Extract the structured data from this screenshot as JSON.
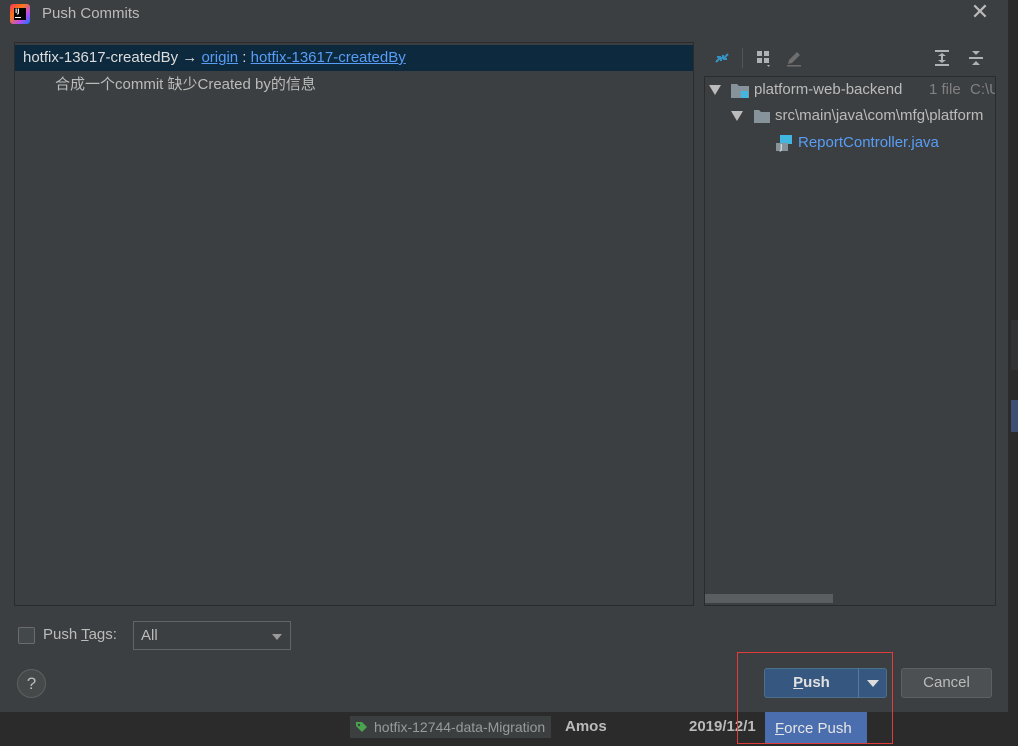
{
  "window": {
    "title": "Push Commits",
    "close_glyph": "✕"
  },
  "commits_panel": {
    "branch_row": {
      "local_branch": "hotfix-13617-createdBy",
      "arrow": "→",
      "remote": "origin",
      "separator": ":",
      "remote_branch": "hotfix-13617-createdBy"
    },
    "commit_message": "合成一个commit 缺少Created by的信息"
  },
  "changes_toolbar": {
    "icons": [
      "sync-icon",
      "group-by-icon",
      "edit-icon",
      "expand-all-icon",
      "collapse-all-icon"
    ]
  },
  "changes_tree": {
    "module": {
      "name": "platform-web-backend",
      "count": "1 file",
      "path": "C:\\Us"
    },
    "directory": {
      "path": "src\\main\\java\\com\\mfg\\platform"
    },
    "file": {
      "name": "ReportController.java"
    }
  },
  "push_tags": {
    "label_before": "Push ",
    "label_mnemonic": "T",
    "label_after": "ags:",
    "selected": "All"
  },
  "buttons": {
    "help": "?",
    "push_mnemonic": "P",
    "push_rest": "ush",
    "cancel": "Cancel",
    "force_push_mnemonic": "F",
    "force_push_rest": "orce Push"
  },
  "background_log": {
    "tag": "hotfix-12744-data-Migration",
    "author": "Amos",
    "date": "2019/12/1"
  },
  "colors": {
    "dialog_bg": "#3c3f41",
    "selection": "#0d293e",
    "link": "#589df6",
    "primary_button": "#365880",
    "popup_highlight": "#4b6eaf",
    "annotation_box": "#e03c3c"
  }
}
